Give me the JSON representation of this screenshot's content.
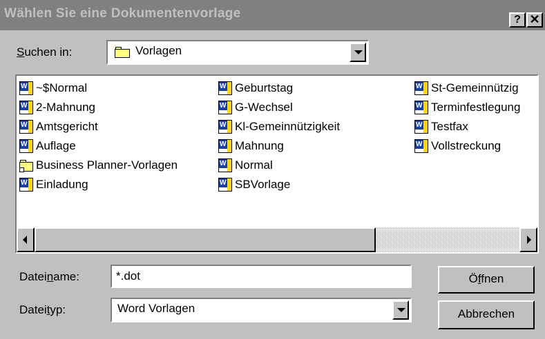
{
  "window": {
    "title": "Wählen Sie eine Dokumentenvorlage",
    "help_label": "?",
    "close_label": "✕"
  },
  "lookin": {
    "label_prefix": "",
    "label_accel": "S",
    "label_rest": "uchen in:",
    "value": "Vorlagen"
  },
  "files": {
    "col1": [
      {
        "name": "~$Normal",
        "icon": "word-template-icon"
      },
      {
        "name": "2-Mahnung",
        "icon": "word-template-icon"
      },
      {
        "name": "Amtsgericht",
        "icon": "word-template-icon"
      },
      {
        "name": "Auflage",
        "icon": "word-template-icon"
      },
      {
        "name": "Business Planner-Vorlagen",
        "icon": "folder-shortcut-icon"
      },
      {
        "name": "Einladung",
        "icon": "word-template-icon"
      }
    ],
    "col2": [
      {
        "name": "Geburtstag",
        "icon": "word-template-icon"
      },
      {
        "name": "G-Wechsel",
        "icon": "word-template-icon"
      },
      {
        "name": "Kl-Gemeinnützigkeit",
        "icon": "word-template-icon"
      },
      {
        "name": "Mahnung",
        "icon": "word-template-icon"
      },
      {
        "name": "Normal",
        "icon": "word-template-icon"
      },
      {
        "name": "SBVorlage",
        "icon": "word-template-icon"
      }
    ],
    "col3": [
      {
        "name": "St-Gemeinnützig",
        "icon": "word-template-icon"
      },
      {
        "name": "Terminfestlegung",
        "icon": "word-template-icon"
      },
      {
        "name": "Testfax",
        "icon": "word-template-icon"
      },
      {
        "name": "Vollstreckung",
        "icon": "word-template-icon"
      }
    ]
  },
  "filename": {
    "label_pre": "Datei",
    "label_accel": "n",
    "label_post": "ame:",
    "value": "*.dot"
  },
  "filetype": {
    "label_pre": "Datei",
    "label_accel": "t",
    "label_post": "yp:",
    "value": "Word Vorlagen"
  },
  "buttons": {
    "open_pre": "Ö",
    "open_accel": "f",
    "open_post": "fnen",
    "cancel": "Abbrechen"
  }
}
